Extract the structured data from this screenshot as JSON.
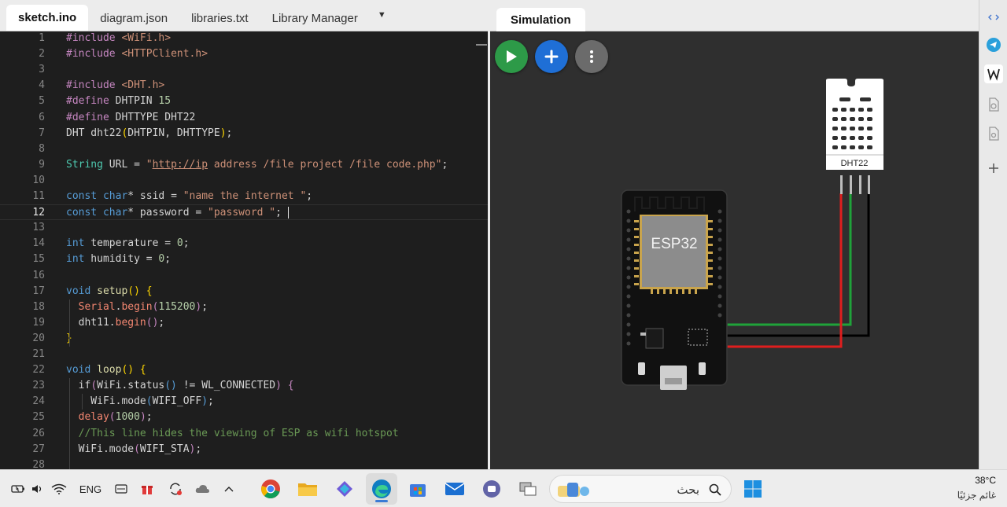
{
  "editor": {
    "tabs": [
      "sketch.ino",
      "diagram.json",
      "libraries.txt",
      "Library Manager"
    ],
    "current_line": 12,
    "code": [
      {
        "n": "1",
        "tokens": [
          [
            "p",
            "#include "
          ],
          [
            "s",
            "<WiFi.h>"
          ]
        ]
      },
      {
        "n": "2",
        "tokens": [
          [
            "p",
            "#include "
          ],
          [
            "s",
            "<HTTPClient.h>"
          ]
        ]
      },
      {
        "n": "3",
        "tokens": []
      },
      {
        "n": "4",
        "tokens": [
          [
            "p",
            "#include "
          ],
          [
            "s",
            "<DHT.h>"
          ]
        ]
      },
      {
        "n": "5",
        "tokens": [
          [
            "p",
            "#define "
          ],
          [
            "d",
            "DHTPIN "
          ],
          [
            "n",
            "15"
          ]
        ]
      },
      {
        "n": "6",
        "tokens": [
          [
            "p",
            "#define "
          ],
          [
            "d",
            "DHTTYPE DHT22"
          ]
        ]
      },
      {
        "n": "7",
        "tokens": [
          [
            "d",
            "DHT dht22"
          ],
          [
            "y",
            "("
          ],
          [
            "d",
            "DHTPIN, DHTTYPE"
          ],
          [
            "y",
            ")"
          ],
          [
            "d",
            ";"
          ]
        ]
      },
      {
        "n": "8",
        "tokens": []
      },
      {
        "n": "9",
        "tokens": [
          [
            "t",
            "String"
          ],
          [
            "d",
            " URL = "
          ],
          [
            "s",
            "\""
          ],
          [
            "su",
            "http://ip"
          ],
          [
            "s",
            " address /file project /file code.php\""
          ],
          [
            "d",
            ";"
          ]
        ]
      },
      {
        "n": "10",
        "tokens": []
      },
      {
        "n": "11",
        "tokens": [
          [
            "k",
            "const"
          ],
          [
            "d",
            " "
          ],
          [
            "k",
            "char"
          ],
          [
            "d",
            "* ssid = "
          ],
          [
            "s",
            "\"name the internet \""
          ],
          [
            "d",
            ";"
          ]
        ]
      },
      {
        "n": "12",
        "tokens": [
          [
            "k",
            "const"
          ],
          [
            "d",
            " "
          ],
          [
            "k",
            "char"
          ],
          [
            "d",
            "* password = "
          ],
          [
            "s",
            "\"password \""
          ],
          [
            "d",
            "; "
          ]
        ]
      },
      {
        "n": "13",
        "tokens": []
      },
      {
        "n": "14",
        "tokens": [
          [
            "k",
            "int"
          ],
          [
            "d",
            " temperature = "
          ],
          [
            "n",
            "0"
          ],
          [
            "d",
            ";"
          ]
        ]
      },
      {
        "n": "15",
        "tokens": [
          [
            "k",
            "int"
          ],
          [
            "d",
            " humidity = "
          ],
          [
            "n",
            "0"
          ],
          [
            "d",
            ";"
          ]
        ]
      },
      {
        "n": "16",
        "tokens": []
      },
      {
        "n": "17",
        "tokens": [
          [
            "k",
            "void"
          ],
          [
            "d",
            " "
          ],
          [
            "f",
            "setup"
          ],
          [
            "y",
            "() {"
          ]
        ]
      },
      {
        "n": "18",
        "tokens": [
          [
            "d",
            "  "
          ],
          [
            "r",
            "Serial"
          ],
          [
            "d",
            "."
          ],
          [
            "r",
            "begin"
          ],
          [
            "p",
            "("
          ],
          [
            "n",
            "115200"
          ],
          [
            "p",
            ")"
          ],
          [
            "d",
            ";"
          ]
        ]
      },
      {
        "n": "19",
        "tokens": [
          [
            "d",
            "  dht11."
          ],
          [
            "r",
            "begin"
          ],
          [
            "p",
            "()"
          ],
          [
            "d",
            ";"
          ]
        ]
      },
      {
        "n": "20",
        "tokens": [
          [
            "y",
            "}"
          ]
        ]
      },
      {
        "n": "21",
        "tokens": []
      },
      {
        "n": "22",
        "tokens": [
          [
            "k",
            "void"
          ],
          [
            "d",
            " "
          ],
          [
            "f",
            "loop"
          ],
          [
            "y",
            "() {"
          ]
        ]
      },
      {
        "n": "23",
        "tokens": [
          [
            "d",
            "  if"
          ],
          [
            "p",
            "("
          ],
          [
            "d",
            "WiFi.status"
          ],
          [
            "k",
            "()"
          ],
          [
            "d",
            " != WL_CONNECTED"
          ],
          [
            "p",
            ")"
          ],
          [
            "d",
            " "
          ],
          [
            "p",
            "{"
          ]
        ]
      },
      {
        "n": "24",
        "tokens": [
          [
            "d",
            "    WiFi.mode"
          ],
          [
            "k",
            "("
          ],
          [
            "d",
            "WIFI_OFF"
          ],
          [
            "k",
            ")"
          ],
          [
            "d",
            ";"
          ]
        ]
      },
      {
        "n": "25",
        "tokens": [
          [
            "d",
            "  "
          ],
          [
            "r",
            "delay"
          ],
          [
            "p",
            "("
          ],
          [
            "n",
            "1000"
          ],
          [
            "p",
            ")"
          ],
          [
            "d",
            ";"
          ]
        ]
      },
      {
        "n": "26",
        "tokens": [
          [
            "c",
            "  //This line hides the viewing of ESP as wifi hotspot"
          ]
        ]
      },
      {
        "n": "27",
        "tokens": [
          [
            "d",
            "  WiFi.mode"
          ],
          [
            "p",
            "("
          ],
          [
            "d",
            "WIFI_STA"
          ],
          [
            "p",
            ")"
          ],
          [
            "d",
            ";"
          ]
        ]
      },
      {
        "n": "28",
        "tokens": []
      }
    ]
  },
  "simulation": {
    "tab_label": "Simulation",
    "board_label": "ESP32",
    "sensor_label": "DHT22"
  },
  "taskbar": {
    "language": "ENG",
    "search_placeholder": "بحث",
    "temperature": "38°C",
    "weather_text": "غائم جزئيًا"
  },
  "colors": {
    "play": "#2d9a48",
    "add": "#1f6fd6",
    "more": "#6b6b6b",
    "wire_green": "#1fa33a",
    "wire_red": "#e01e1e",
    "wire_black": "#000000"
  }
}
